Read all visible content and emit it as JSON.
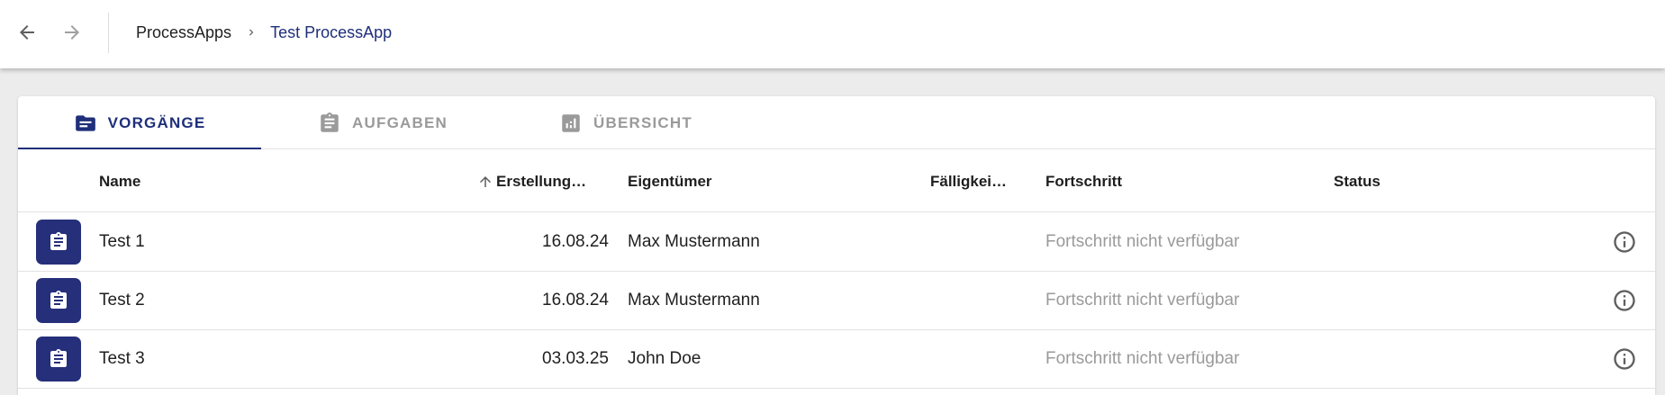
{
  "header": {
    "back_icon": "arrow-left-icon",
    "forward_icon": "arrow-right-icon",
    "breadcrumb": [
      {
        "label": "ProcessApps"
      },
      {
        "label": "Test ProcessApp"
      }
    ],
    "breadcrumb_separator_icon": "chevron-right-icon"
  },
  "tabs": [
    {
      "label": "VORGÄNGE",
      "icon": "folder-icon",
      "active": true
    },
    {
      "label": "AUFGABEN",
      "icon": "clipboard-icon",
      "active": false
    },
    {
      "label": "ÜBERSICHT",
      "icon": "bar-chart-icon",
      "active": false
    }
  ],
  "table": {
    "columns": {
      "name": "Name",
      "created": "Erstellung…",
      "owner": "Eigentümer",
      "due": "Fälligkei…",
      "progress": "Fortschritt",
      "status": "Status"
    },
    "sort_icon": "arrow-up-icon",
    "rows": [
      {
        "name": "Test 1",
        "created": "16.08.24",
        "owner": "Max Mustermann",
        "due": "",
        "progress": "Fortschritt nicht verfügbar",
        "status": ""
      },
      {
        "name": "Test 2",
        "created": "16.08.24",
        "owner": "Max Mustermann",
        "due": "",
        "progress": "Fortschritt nicht verfügbar",
        "status": ""
      },
      {
        "name": "Test 3",
        "created": "03.03.25",
        "owner": "John Doe",
        "due": "",
        "progress": "Fortschritt nicht verfügbar",
        "status": ""
      }
    ],
    "row_icon": "clipboard-icon",
    "info_icon": "info-circle-icon"
  },
  "colors": {
    "accent": "#1f2f7a",
    "row_icon_bg": "#26307a",
    "muted_text": "#9a9a9a"
  }
}
